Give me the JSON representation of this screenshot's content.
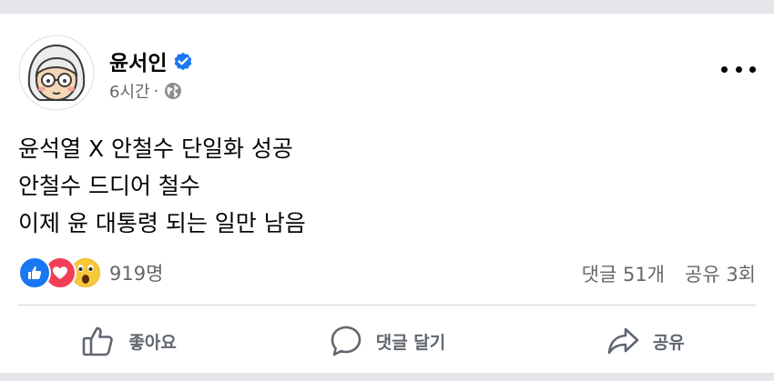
{
  "post": {
    "author": "윤서인",
    "time": "6시간",
    "separator": "·",
    "text_lines": [
      "윤석열 X 안철수 단일화 성공",
      "안철수 드디어 철수",
      "이제 윤 대통령 되는 일만 남음"
    ]
  },
  "stats": {
    "reaction_count": "919명",
    "comments": "댓글 51개",
    "shares": "공유 3회"
  },
  "actions": {
    "like_label": "좋아요",
    "comment_label": "댓글 달기",
    "share_label": "공유"
  },
  "icons": {
    "verified": "verified-badge-icon",
    "audience": "globe-icon",
    "more": "more-options-icon",
    "reactions": [
      "like-reaction-icon",
      "love-reaction-icon",
      "wow-reaction-icon"
    ],
    "like": "thumbs-up-icon",
    "comment": "comment-bubble-icon",
    "share": "share-arrow-icon"
  },
  "colors": {
    "background": "#ffffff",
    "separator_strip": "#e4e6eb",
    "text": "#050505",
    "secondary_text": "#65676b",
    "verified_blue": "#1877f2",
    "like_blue": "#1877f2",
    "love_red": "#f33e58",
    "wow_yellow": "#f7b125"
  }
}
